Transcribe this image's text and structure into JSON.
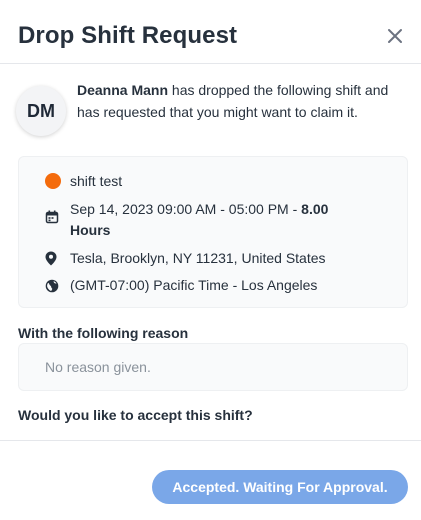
{
  "header": {
    "title": "Drop Shift Request",
    "close_icon": "close-icon"
  },
  "requester": {
    "initials": "DM",
    "name": "Deanna Mann",
    "message": " has dropped the following shift and has requested that you might want to claim it."
  },
  "shift": {
    "name": "shift test",
    "status_color": "#F46B0C",
    "datetime": "Sep 14, 2023 09:00 AM - 05:00 PM - ",
    "duration": "8.00 Hours",
    "location": "Tesla, Brooklyn, NY 11231, United States",
    "timezone": "(GMT-07:00) Pacific Time - Los Angeles"
  },
  "reason": {
    "label": "With the following reason",
    "text": "No reason given."
  },
  "question": "Would you like to accept this shift?",
  "actions": {
    "accept_label": "Accepted. Waiting For Approval."
  },
  "colors": {
    "accent": "#7AA7E8",
    "panel_bg": "#F9FAFB"
  }
}
